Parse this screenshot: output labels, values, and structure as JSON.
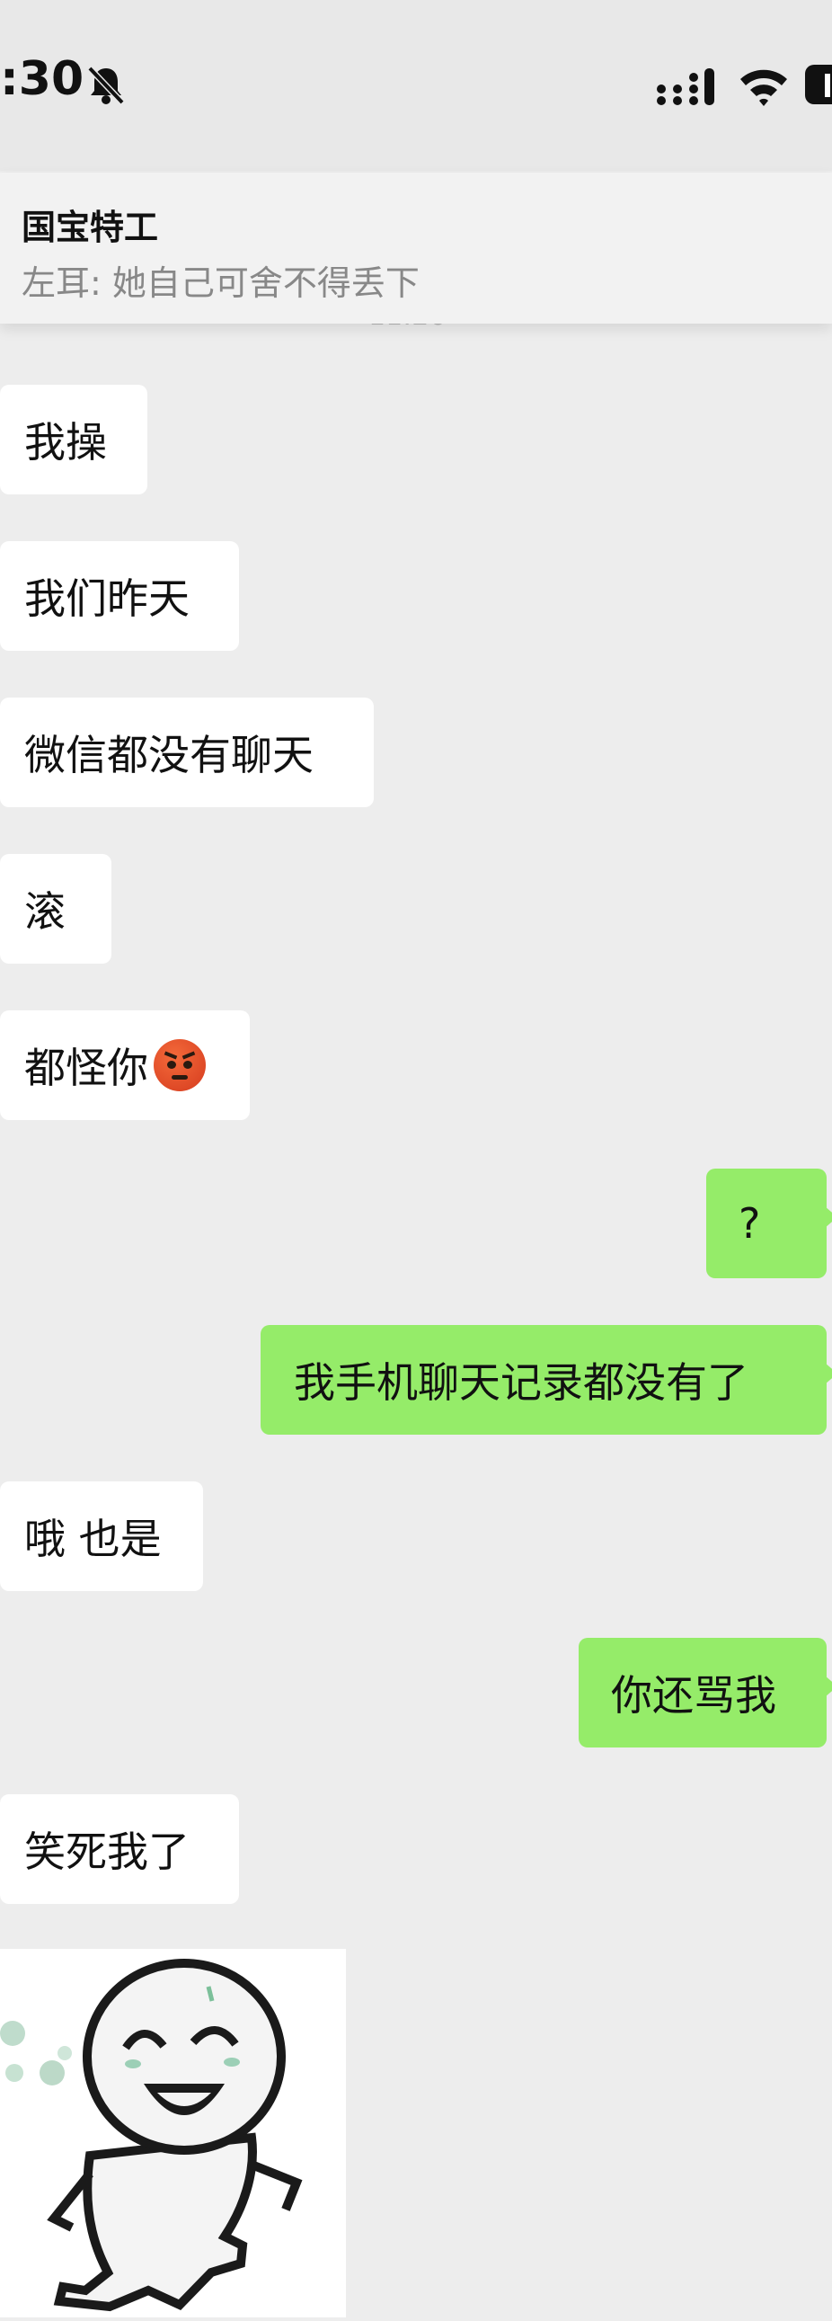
{
  "status_bar": {
    "time": ":30",
    "icons": [
      "bell-muted-icon",
      "cellular-signal-icon",
      "wifi-icon",
      "battery-icon"
    ]
  },
  "notification": {
    "title": "国宝特工",
    "message": "左耳: 她自己可舍不得丢下",
    "partially_hidden_time": "11:26"
  },
  "messages": [
    {
      "side": "left",
      "text": "我操"
    },
    {
      "side": "left",
      "text": "我们昨天"
    },
    {
      "side": "left",
      "text": "微信都没有聊天"
    },
    {
      "side": "left",
      "text": "滚"
    },
    {
      "side": "left",
      "text": "都怪你",
      "emoji": "angry-face-icon"
    },
    {
      "side": "right",
      "text": "?"
    },
    {
      "side": "right",
      "text": "我手机聊天记录都没有了"
    },
    {
      "side": "left",
      "text": "哦 也是"
    },
    {
      "side": "right",
      "text": "你还骂我"
    },
    {
      "side": "left",
      "text": "笑死我了"
    },
    {
      "side": "left",
      "sticker": "laughing-ghost-sticker"
    }
  ],
  "colors": {
    "background": "#ededed",
    "left_bubble": "#ffffff",
    "right_bubble": "#95ec69",
    "notification_background": "#f2f2f2"
  }
}
